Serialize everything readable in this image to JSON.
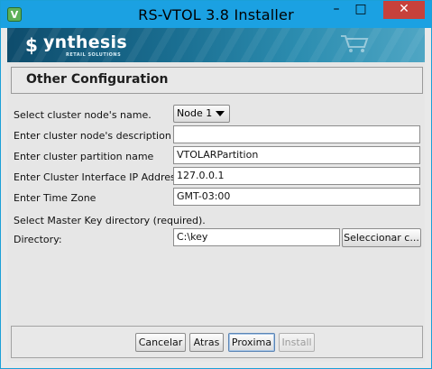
{
  "window": {
    "title": "RS-VTOL 3.8 Installer",
    "icon_glyph": "V",
    "controls": {
      "minimize": "–",
      "maximize": "□",
      "close": "✕"
    }
  },
  "banner": {
    "logo_mark": "$",
    "logo_text": "ynthesis",
    "logo_sub": "RETAIL SOLUTIONS",
    "icon": "shopping-cart-icon"
  },
  "section": {
    "title": "Other Configuration"
  },
  "form": {
    "node_name": {
      "label": "Select cluster node's name.",
      "value": "Node 1"
    },
    "node_description": {
      "label": "Enter cluster node's description",
      "value": ""
    },
    "partition_name": {
      "label": "Enter cluster partition name",
      "value": "VTOLARPartition"
    },
    "interface_ip": {
      "label": "Enter Cluster Interface IP Address",
      "value": "127.0.0.1"
    },
    "time_zone": {
      "label": "Enter Time Zone",
      "value": "GMT-03:00"
    },
    "master_key_note": "Select Master Key directory (required).",
    "directory": {
      "label": "Directory:",
      "value": "C:\\key",
      "browse_label": "Seleccionar c..."
    }
  },
  "footer": {
    "cancel": "Cancelar",
    "back": "Atras",
    "next": "Proxima",
    "install": "Install"
  },
  "colors": {
    "titlebar": "#1ba1e2",
    "close_button": "#c7413b",
    "banner": "#1a6e91"
  }
}
